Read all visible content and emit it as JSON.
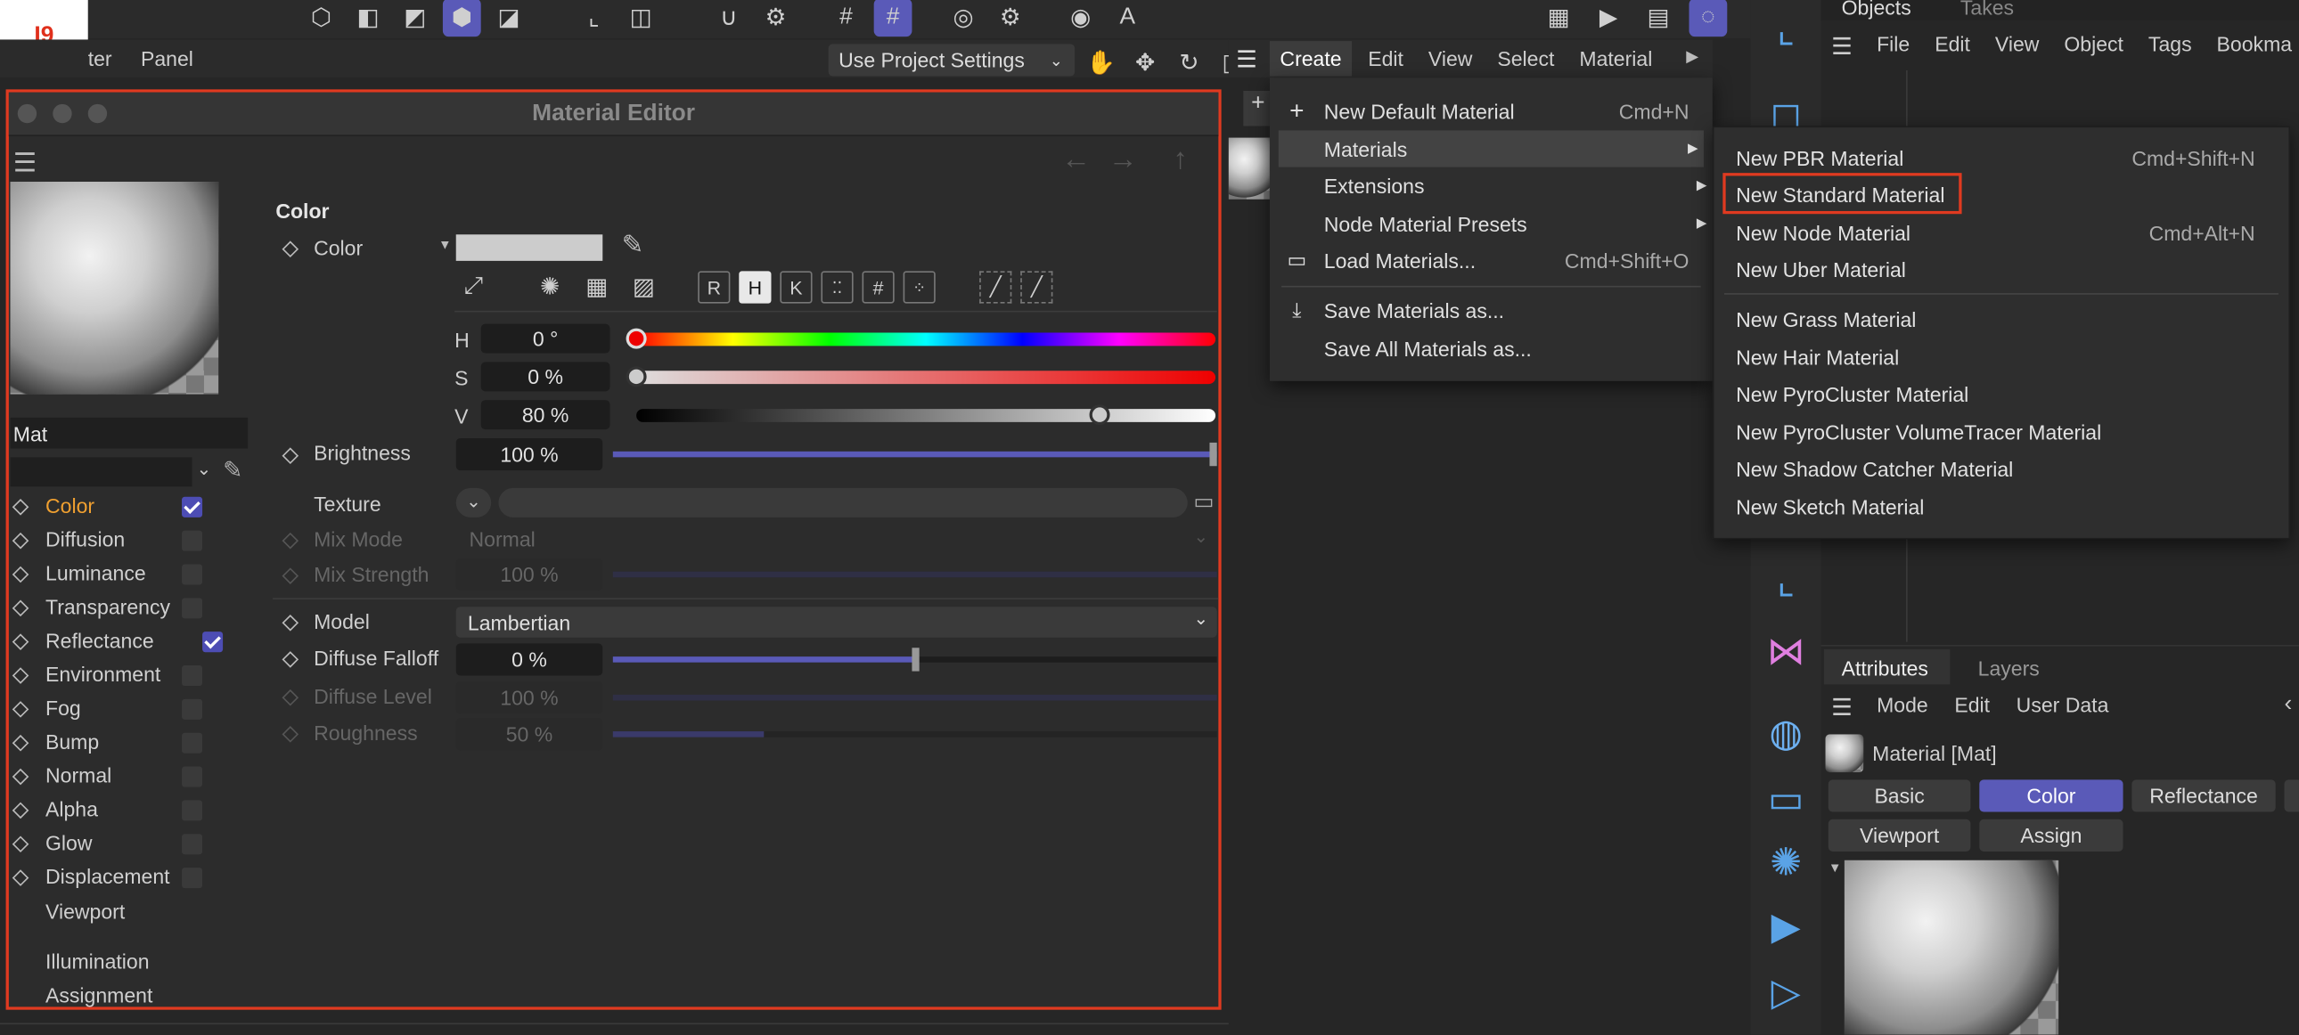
{
  "badge": "I9",
  "topbar": {
    "left_menu": [
      "ter",
      "Panel"
    ],
    "project_settings": "Use Project Settings"
  },
  "create_menubar": [
    "Create",
    "Edit",
    "View",
    "Select",
    "Material"
  ],
  "objects_panel": {
    "tabs": [
      "Objects",
      "Takes"
    ],
    "menu": [
      "File",
      "Edit",
      "View",
      "Object",
      "Tags",
      "Bookma"
    ]
  },
  "material_editor": {
    "title": "Material Editor",
    "mat_name": "Mat",
    "channels": [
      {
        "label": "Color",
        "checked": true,
        "active": true
      },
      {
        "label": "Diffusion",
        "checked": false
      },
      {
        "label": "Luminance",
        "checked": false
      },
      {
        "label": "Transparency",
        "checked": false
      },
      {
        "label": "Reflectance",
        "checked": true
      },
      {
        "label": "Environment",
        "checked": false
      },
      {
        "label": "Fog",
        "checked": false
      },
      {
        "label": "Bump",
        "checked": false
      },
      {
        "label": "Normal",
        "checked": false
      },
      {
        "label": "Alpha",
        "checked": false
      },
      {
        "label": "Glow",
        "checked": false
      },
      {
        "label": "Displacement",
        "checked": false
      }
    ],
    "extra_items": [
      "Viewport",
      "Illumination",
      "Assignment"
    ],
    "section_title": "Color",
    "color_label": "Color",
    "mode_buttons": [
      "R",
      "H",
      "K",
      "#"
    ],
    "hsv": {
      "h_label": "H",
      "h_value": "0 °",
      "h_pos": 0,
      "s_label": "S",
      "s_value": "0 %",
      "s_pos": 0,
      "v_label": "V",
      "v_value": "80 %",
      "v_pos": 0.8
    },
    "brightness": {
      "label": "Brightness",
      "value": "100 %",
      "level": 1.0
    },
    "texture": {
      "label": "Texture"
    },
    "mix_mode": {
      "label": "Mix Mode",
      "value": "Normal"
    },
    "mix_strength": {
      "label": "Mix Strength",
      "value": "100 %"
    },
    "model": {
      "label": "Model",
      "value": "Lambertian"
    },
    "diffuse_falloff": {
      "label": "Diffuse Falloff",
      "value": "0 %",
      "level": 0.5
    },
    "diffuse_level": {
      "label": "Diffuse Level",
      "value": "100 %"
    },
    "roughness": {
      "label": "Roughness",
      "value": "50 %",
      "level": 0.25
    }
  },
  "create_dropdown": {
    "items": [
      {
        "label": "New Default Material",
        "shortcut": "Cmd+N"
      },
      {
        "label": "Materials",
        "highlighted": true
      },
      {
        "label": "Extensions"
      },
      {
        "label": "Node Material Presets"
      },
      {
        "label": "Load Materials...",
        "shortcut": "Cmd+Shift+O"
      },
      {
        "label": "Save Materials as..."
      },
      {
        "label": "Save All Materials as..."
      }
    ]
  },
  "materials_submenu": {
    "items": [
      {
        "label": "New PBR Material",
        "shortcut": "Cmd+Shift+N"
      },
      {
        "label": "New Standard Material",
        "boxed": true
      },
      {
        "label": "New Node Material",
        "shortcut": "Cmd+Alt+N"
      },
      {
        "label": "New Uber Material"
      },
      {
        "label": "New Grass Material"
      },
      {
        "label": "New Hair Material"
      },
      {
        "label": "New PyroCluster Material"
      },
      {
        "label": "New PyroCluster VolumeTracer Material"
      },
      {
        "label": "New Shadow Catcher Material"
      },
      {
        "label": "New Sketch Material"
      }
    ]
  },
  "attributes_panel": {
    "tabs": [
      "Attributes",
      "Layers"
    ],
    "menu": [
      "Mode",
      "Edit",
      "User Data"
    ],
    "object_name": "Material [Mat]",
    "buttons": [
      "Basic",
      "Color",
      "Reflectance",
      "Viewport",
      "Assign"
    ]
  },
  "colors": {
    "accent": "#5a5ab8",
    "highlight_box": "#e03a20",
    "editor_border": "#e03a20"
  }
}
